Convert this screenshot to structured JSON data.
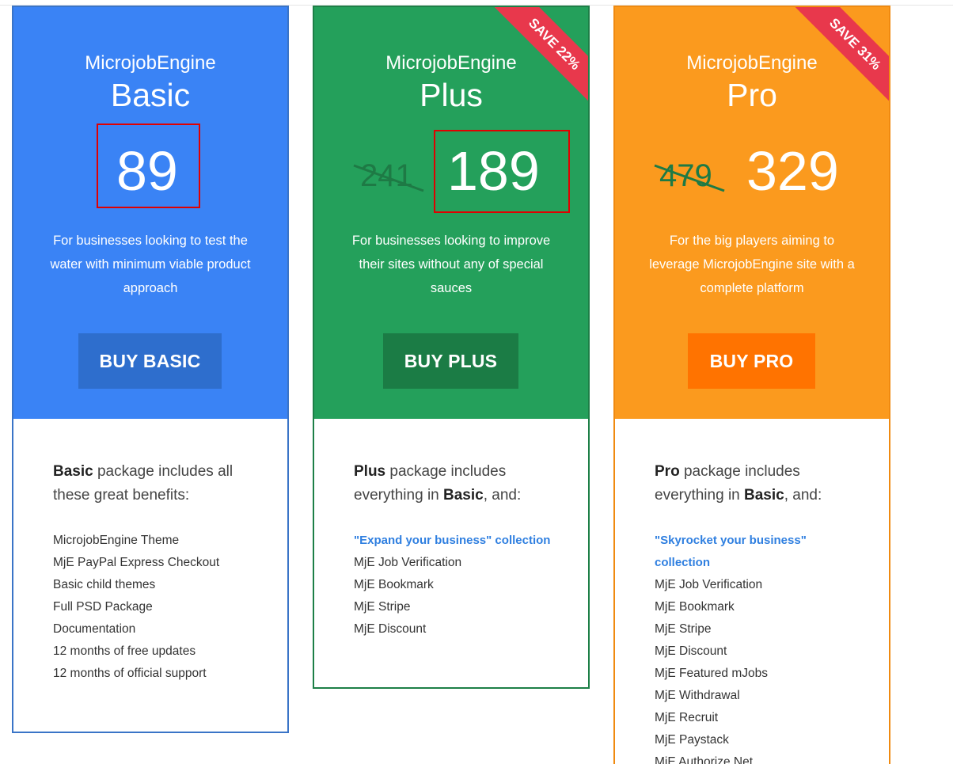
{
  "brand": "MicrojobEngine",
  "basic": {
    "tier": "Basic",
    "price": "89",
    "description": "For businesses looking to test the water with minimum viable product approach",
    "buy_label": "BUY BASIC",
    "intro_name": "Basic",
    "intro_text": " package includes all these great benefits:",
    "features": [
      "MicrojobEngine Theme",
      "MjE PayPal Express Checkout",
      "Basic child themes",
      "Full PSD Package",
      "Documentation",
      "12 months of free updates",
      "12 months of official support"
    ]
  },
  "plus": {
    "tier": "Plus",
    "old_price": "241",
    "price": "189",
    "ribbon": "SAVE 22%",
    "description": "For businesses looking to improve their sites without any of special sauces",
    "buy_label": "BUY PLUS",
    "intro_name": "Plus",
    "intro_text_1": " package includes everything in ",
    "intro_ref": "Basic",
    "intro_text_2": ", and:",
    "collection": "\"Expand your business\" collection",
    "features": [
      "MjE Job Verification",
      "MjE Bookmark",
      "MjE Stripe",
      "MjE Discount"
    ]
  },
  "pro": {
    "tier": "Pro",
    "old_price": "479",
    "price": "329",
    "ribbon": "SAVE 31%",
    "description": "For the big players aiming to leverage MicrojobEngine site with a complete platform",
    "buy_label": "BUY PRO",
    "intro_name": "Pro",
    "intro_text_1": " package includes everything in ",
    "intro_ref": "Basic",
    "intro_text_2": ", and:",
    "collection": "\"Skyrocket your business\" collection",
    "features": [
      "MjE Job Verification",
      "MjE Bookmark",
      "MjE Stripe",
      "MjE Discount",
      "MjE Featured mJobs",
      "MjE Withdrawal",
      "MjE Recruit",
      "MjE Paystack",
      "MjE Authorize.Net"
    ]
  },
  "colors": {
    "basic": "#3a83f5",
    "plus": "#24a05b",
    "pro": "#fb9a1e",
    "ribbon": "#e8384c",
    "highlight": "#e00000",
    "link": "#2f7fe0"
  }
}
